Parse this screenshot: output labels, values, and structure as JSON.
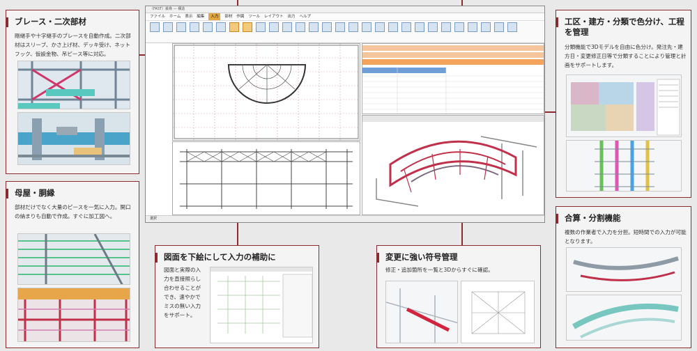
{
  "main_window": {
    "title": "（FAST）鉄骨 — 構造",
    "menu": [
      "ファイル",
      "ホーム",
      "表示",
      "編集",
      "入力",
      "部材",
      "作図",
      "ツール",
      "レイアウト",
      "出力",
      "ヘルプ"
    ],
    "active_menu": "入力",
    "status": "選択"
  },
  "panels": {
    "brace": {
      "title": "ブレース・二次部材",
      "body": "剛継手や十字継手のブレースを自動作成。二次部材はスリーブ、かさ上げ材、デッキ受け、ネットフック、仮設金物、吊ピース等に対応。"
    },
    "purlin": {
      "title": "母屋・胴縁",
      "body": "部材だけでなく大量のピースを一気に入力。開口の納まりも自動で作成。すぐに加工図へ。"
    },
    "underlay": {
      "title": "図面を下絵にして入力の補助に",
      "body": "図面と実際の入力を直接照らし合わせることができ、速やかでミスの無い入力をサポート。"
    },
    "symbol": {
      "title": "変更に強い符号管理",
      "body": "修正・追加箇所を一覧と3Dからすぐに確認。"
    },
    "color": {
      "title": "工区・建方・分類で色分け、工程を管理",
      "body": "分類機能で3Dモデルを自由に色分け。発注先・建方日・変更修正日等で分類することにより管理と計画をサポートします。"
    },
    "merge": {
      "title": "合算・分割機能",
      "body": "複数の作業者で入力を分担。短時間での入力が可能となります。"
    }
  },
  "colors": {
    "accent": "#8b2a2f",
    "highlight": "#e4a640",
    "steel_red": "#c0304a"
  }
}
